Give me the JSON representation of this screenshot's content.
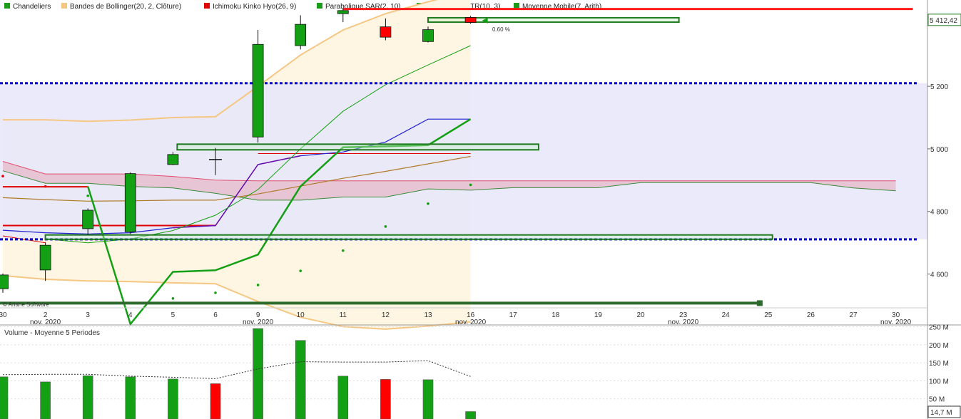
{
  "chart_data": [
    {
      "type": "candlestick",
      "legend": [
        {
          "label": "Chandeliers",
          "color": "#1a9c1a"
        },
        {
          "label": "Bandes de Bollinger(20, 2, Clôture)",
          "color": "#f5c782"
        },
        {
          "label": "Ichimoku Kinko Hyo(26, 9)",
          "color": "#e00000"
        },
        {
          "label": "Parabolique SAR(2, 10)",
          "color": "#1a9c1a"
        },
        {
          "label": "Super Trend ATR(10, 3)",
          "color": "#1a9c1a"
        },
        {
          "label": "Moyenne Mobile(7, Arith)",
          "color": "#1a9c1a"
        }
      ],
      "x_ticks": [
        {
          "day": "30",
          "month": ""
        },
        {
          "day": "2",
          "month": "nov. 2020"
        },
        {
          "day": "3",
          "month": ""
        },
        {
          "day": "4",
          "month": ""
        },
        {
          "day": "5",
          "month": ""
        },
        {
          "day": "6",
          "month": ""
        },
        {
          "day": "9",
          "month": "nov. 2020"
        },
        {
          "day": "10",
          "month": ""
        },
        {
          "day": "11",
          "month": ""
        },
        {
          "day": "12",
          "month": ""
        },
        {
          "day": "13",
          "month": ""
        },
        {
          "day": "16",
          "month": "nov. 2020"
        },
        {
          "day": "17",
          "month": ""
        },
        {
          "day": "18",
          "month": ""
        },
        {
          "day": "19",
          "month": ""
        },
        {
          "day": "20",
          "month": ""
        },
        {
          "day": "23",
          "month": "nov. 2020"
        },
        {
          "day": "24",
          "month": ""
        },
        {
          "day": "25",
          "month": ""
        },
        {
          "day": "26",
          "month": ""
        },
        {
          "day": "27",
          "month": ""
        },
        {
          "day": "30",
          "month": "nov. 2020"
        }
      ],
      "y_ticks": [
        "4 600",
        "4 800",
        "5 000",
        "5 200"
      ],
      "y_tick_values": [
        4600,
        4800,
        5000,
        5200
      ],
      "ylim": [
        4492,
        5453
      ],
      "last_price_label": "5 412,42",
      "last_price": 5412.42,
      "last_candle_note": "0.60 %",
      "copyright": "© Ariane Software",
      "candles": [
        {
          "i": 0,
          "open": 4553,
          "high": 4602,
          "low": 4540,
          "close": 4597,
          "color": "green"
        },
        {
          "i": 1,
          "open": 4613,
          "high": 4702,
          "low": 4578,
          "close": 4692,
          "color": "green"
        },
        {
          "i": 2,
          "open": 4745,
          "high": 4810,
          "low": 4725,
          "close": 4804,
          "color": "green"
        },
        {
          "i": 3,
          "open": 4735,
          "high": 4925,
          "low": 4728,
          "close": 4921,
          "color": "green"
        },
        {
          "i": 4,
          "open": 4950,
          "high": 4990,
          "low": 4948,
          "close": 4982,
          "color": "green"
        },
        {
          "i": 5,
          "open": 4966,
          "high": 5003,
          "low": 4916,
          "close": 4966,
          "color": "doji"
        },
        {
          "i": 6,
          "open": 5038,
          "high": 5380,
          "low": 5020,
          "close": 5334,
          "color": "green"
        },
        {
          "i": 7,
          "open": 5330,
          "high": 5427,
          "low": 5318,
          "close": 5398,
          "color": "green"
        },
        {
          "i": 8,
          "open": 5432,
          "high": 5448,
          "low": 5405,
          "close": 5442,
          "color": "green"
        },
        {
          "i": 9,
          "open": 5390,
          "high": 5417,
          "low": 5347,
          "close": 5357,
          "color": "red"
        },
        {
          "i": 10,
          "open": 5343,
          "high": 5391,
          "low": 5340,
          "close": 5381,
          "color": "green"
        },
        {
          "i": 11,
          "open": 5420,
          "high": 5425,
          "low": 5400,
          "close": 5404,
          "color": "red"
        }
      ],
      "bollinger_mid": [
        [
          0,
          4844
        ],
        [
          1,
          4838
        ],
        [
          2,
          4833
        ],
        [
          3,
          4834
        ],
        [
          4,
          4836
        ],
        [
          5,
          4836
        ],
        [
          6,
          4856
        ],
        [
          7,
          4881
        ],
        [
          8,
          4906
        ],
        [
          9,
          4928
        ],
        [
          10,
          4952
        ],
        [
          11,
          4976
        ]
      ],
      "bollinger_upper": [
        [
          0,
          5093
        ],
        [
          1,
          5093
        ],
        [
          2,
          5088
        ],
        [
          3,
          5092
        ],
        [
          4,
          5100
        ],
        [
          5,
          5103
        ],
        [
          6,
          5200
        ],
        [
          7,
          5300
        ],
        [
          8,
          5380
        ],
        [
          9,
          5432
        ],
        [
          10,
          5470
        ],
        [
          11,
          5505
        ]
      ],
      "bollinger_lower": [
        [
          0,
          4595
        ],
        [
          1,
          4583
        ],
        [
          2,
          4578
        ],
        [
          3,
          4576
        ],
        [
          4,
          4572
        ],
        [
          5,
          4569
        ],
        [
          6,
          4512
        ],
        [
          7,
          4462
        ],
        [
          8,
          4432
        ],
        [
          9,
          4424
        ],
        [
          10,
          4434
        ],
        [
          11,
          4447
        ]
      ],
      "ichimoku_tenkan": [
        [
          0,
          4879
        ],
        [
          1,
          4879
        ],
        [
          2,
          4879
        ]
      ],
      "ichimoku_kijun": [
        [
          0,
          4755
        ],
        [
          1,
          4755
        ],
        [
          2,
          4755
        ],
        [
          3,
          4755
        ],
        [
          4,
          4755
        ],
        [
          5,
          4755
        ]
      ],
      "ichimoku_kijun_high": [
        [
          6,
          4985
        ],
        [
          7,
          4985
        ],
        [
          8,
          4985
        ],
        [
          9,
          4985
        ],
        [
          10,
          4985
        ],
        [
          11,
          4985
        ]
      ],
      "ichimoku_senkou_a": [
        [
          0,
          4960
        ],
        [
          1,
          4920
        ],
        [
          2,
          4920
        ],
        [
          3,
          4920
        ],
        [
          4,
          4912
        ],
        [
          5,
          4900
        ],
        [
          6,
          4898
        ],
        [
          7,
          4898
        ],
        [
          8,
          4898
        ],
        [
          9,
          4898
        ],
        [
          10,
          4898
        ],
        [
          11,
          4898
        ],
        [
          12,
          4898
        ],
        [
          13,
          4898
        ],
        [
          14,
          4898
        ],
        [
          15,
          4898
        ],
        [
          16,
          4898
        ],
        [
          17,
          4898
        ],
        [
          18,
          4898
        ],
        [
          19,
          4898
        ],
        [
          20,
          4898
        ],
        [
          21,
          4898
        ]
      ],
      "ichimoku_senkou_b": [
        [
          0,
          4930
        ],
        [
          1,
          4890
        ],
        [
          2,
          4890
        ],
        [
          3,
          4880
        ],
        [
          4,
          4875
        ],
        [
          5,
          4858
        ],
        [
          6,
          4836
        ],
        [
          7,
          4836
        ],
        [
          8,
          4846
        ],
        [
          9,
          4846
        ],
        [
          10,
          4872
        ],
        [
          11,
          4868
        ],
        [
          12,
          4876
        ],
        [
          13,
          4876
        ],
        [
          14,
          4876
        ],
        [
          15,
          4892
        ],
        [
          16,
          4892
        ],
        [
          17,
          4892
        ],
        [
          18,
          4892
        ],
        [
          19,
          4892
        ],
        [
          20,
          4875
        ],
        [
          21,
          4866
        ]
      ],
      "chikou": [
        [
          0,
          4742
        ],
        [
          1,
          4732
        ],
        [
          2,
          4728
        ],
        [
          3,
          4732
        ],
        [
          4,
          4748
        ],
        [
          5,
          4755
        ],
        [
          6,
          4950
        ],
        [
          7,
          4978
        ],
        [
          8,
          4990
        ],
        [
          9,
          5022
        ],
        [
          10,
          5095
        ],
        [
          11,
          5095
        ]
      ],
      "psar": [
        [
          0,
          4913
        ],
        [
          1,
          4880
        ],
        [
          2,
          4850
        ],
        [
          4,
          4522
        ],
        [
          5,
          4540
        ],
        [
          6,
          4565
        ],
        [
          7,
          4610
        ],
        [
          8,
          4675
        ],
        [
          9,
          4752
        ],
        [
          10,
          4825
        ],
        [
          11,
          4885
        ]
      ],
      "supertrend": [
        [
          2,
          4880
        ],
        [
          3,
          4440
        ],
        [
          4,
          4607
        ],
        [
          5,
          4612
        ],
        [
          6,
          4662
        ],
        [
          7,
          4880
        ],
        [
          8,
          5005
        ],
        [
          9,
          5008
        ],
        [
          10,
          5012
        ],
        [
          11,
          5095
        ]
      ],
      "moving_average": [
        [
          1,
          4712
        ],
        [
          2,
          4700
        ],
        [
          3,
          4712
        ],
        [
          4,
          4739
        ],
        [
          5,
          4788
        ],
        [
          6,
          4870
        ],
        [
          7,
          5000
        ],
        [
          8,
          5120
        ],
        [
          9,
          5205
        ],
        [
          10,
          5268
        ],
        [
          11,
          5330
        ]
      ],
      "horizontal_levels": [
        {
          "name": "resistance-red",
          "value": 5447,
          "from": 8,
          "to": 21.4,
          "color": "#ff1a1a"
        },
        {
          "name": "dotted-high",
          "value": 5210,
          "from": -0.1,
          "to": 21.5,
          "color": "#0000c8"
        },
        {
          "name": "dotted-low",
          "value": 4711,
          "from": -0.1,
          "to": 21.5,
          "color": "#0000c8"
        },
        {
          "name": "support-dark",
          "value": 4507,
          "from": -0.1,
          "to": 17.8,
          "color": "#2d6a2d"
        }
      ],
      "zones": [
        {
          "name": "zone-top",
          "from": 10,
          "to": 15.9,
          "y1": 5419,
          "y2": 5405
        },
        {
          "name": "zone-mid",
          "from": 4.1,
          "to": 12.6,
          "y1": 5015,
          "y2": 4997
        },
        {
          "name": "zone-low",
          "from": 1,
          "to": 18.1,
          "y1": 4725,
          "y2": 4711
        }
      ]
    },
    {
      "type": "bar",
      "title": "Volume  - Moyenne 5 Periodes",
      "y_ticks": [
        "250 M",
        "200 M",
        "150 M",
        "100 M",
        "50 M"
      ],
      "y_tick_values": [
        250,
        200,
        150,
        100,
        50
      ],
      "ylim": [
        0,
        255
      ],
      "last_volume_label": "14,7 M",
      "unit": "M",
      "volumes": [
        {
          "i": 0,
          "value": 111,
          "color": "green"
        },
        {
          "i": 1,
          "value": 97,
          "color": "green"
        },
        {
          "i": 2,
          "value": 114,
          "color": "green"
        },
        {
          "i": 3,
          "value": 111,
          "color": "green"
        },
        {
          "i": 4,
          "value": 105,
          "color": "green"
        },
        {
          "i": 5,
          "value": 92,
          "color": "red"
        },
        {
          "i": 6,
          "value": 245,
          "color": "green"
        },
        {
          "i": 7,
          "value": 212,
          "color": "green"
        },
        {
          "i": 8,
          "value": 113,
          "color": "green"
        },
        {
          "i": 9,
          "value": 104,
          "color": "red"
        },
        {
          "i": 10,
          "value": 103,
          "color": "green"
        },
        {
          "i": 11,
          "value": 14.7,
          "color": "green"
        }
      ],
      "moving_average": [
        [
          0,
          117
        ],
        [
          1,
          118
        ],
        [
          2,
          118
        ],
        [
          3,
          113
        ],
        [
          4,
          110
        ],
        [
          5,
          106
        ],
        [
          6,
          133
        ],
        [
          7,
          153
        ],
        [
          8,
          152
        ],
        [
          9,
          152
        ],
        [
          10,
          156
        ],
        [
          11,
          112
        ]
      ]
    }
  ],
  "colors": {
    "up": "#14a014",
    "down": "#ff0000",
    "cloud_up": "#e6b8c8",
    "cloud_down": "#c8e6c8",
    "zone_fill": "#e6e6fa",
    "bb_fill": "#fff5e3"
  }
}
